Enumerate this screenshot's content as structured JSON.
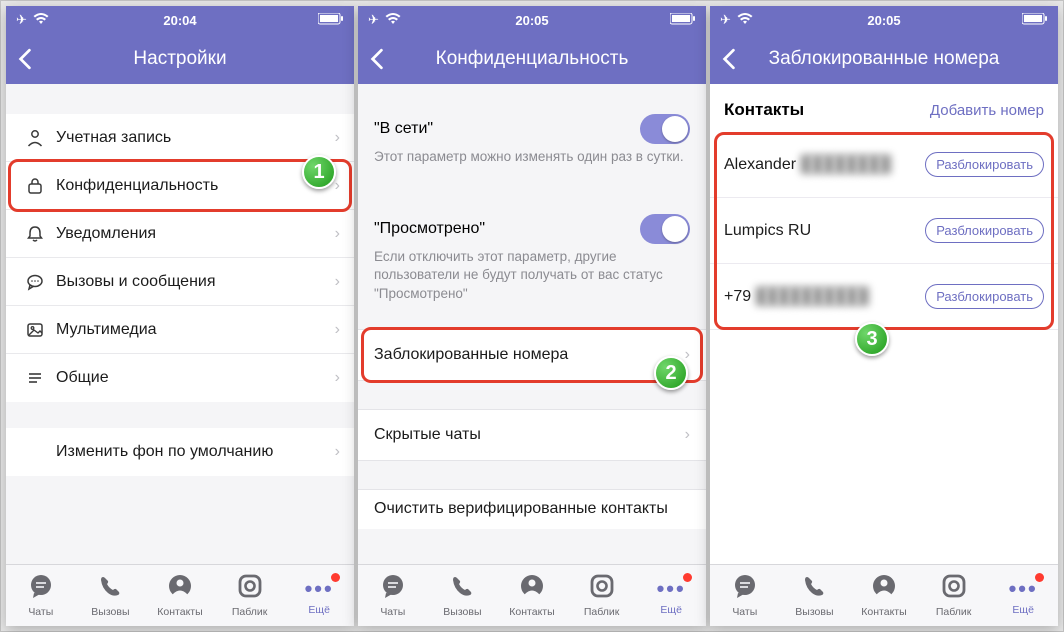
{
  "status": {
    "time1": "20:04",
    "time2": "20:05",
    "time3": "20:05"
  },
  "screens": {
    "s1": {
      "title": "Настройки",
      "rows": {
        "account": "Учетная запись",
        "privacy": "Конфиденциальность",
        "notifications": "Уведомления",
        "calls": "Вызовы и сообщения",
        "media": "Мультимедиа",
        "general": "Общие",
        "wallpaper": "Изменить фон по умолчанию"
      }
    },
    "s2": {
      "title": "Конфиденциальность",
      "online_label": "\"В сети\"",
      "online_desc": "Этот параметр можно изменять один раз в сутки.",
      "seen_label": "\"Просмотрено\"",
      "seen_desc": "Если отключить этот параметр, другие пользователи не будут получать от вас статус \"Просмотрено\"",
      "blocked": "Заблокированные номера",
      "hidden": "Скрытые чаты",
      "clear": "Очистить верифицированные контакты"
    },
    "s3": {
      "title": "Заблокированные номера",
      "heading": "Контакты",
      "add": "Добавить номер",
      "unblock": "Разблокировать",
      "contacts": [
        {
          "name": "Alexander",
          "suffix": "████████"
        },
        {
          "name": "Lumpics RU",
          "suffix": ""
        },
        {
          "name": "+79",
          "suffix": "██████████"
        }
      ]
    }
  },
  "tabs": {
    "chats": "Чаты",
    "calls": "Вызовы",
    "contacts": "Контакты",
    "public": "Паблик",
    "more": "Ещё"
  },
  "badges": {
    "b1": "1",
    "b2": "2",
    "b3": "3"
  }
}
